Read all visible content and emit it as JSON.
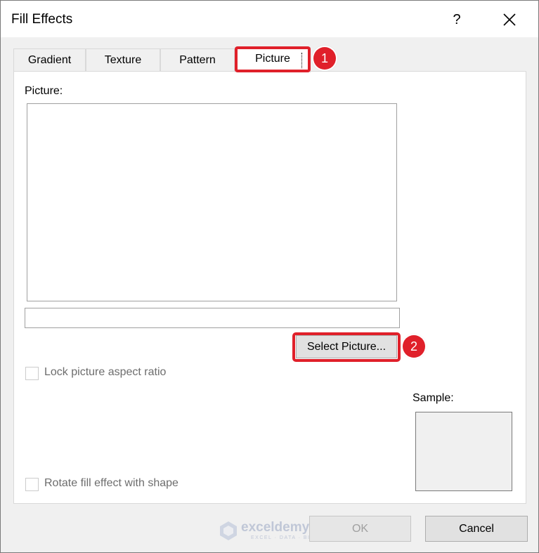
{
  "dialog": {
    "title": "Fill Effects",
    "help_label": "?"
  },
  "tabs": [
    {
      "label": "Gradient"
    },
    {
      "label": "Texture"
    },
    {
      "label": "Pattern"
    },
    {
      "label": "Picture",
      "active": true
    }
  ],
  "annotations": {
    "step1": "1",
    "step2": "2",
    "highlight_color": "#e0202a"
  },
  "panel": {
    "picture_label": "Picture:",
    "select_button": "Select Picture...",
    "lock_aspect_label": "Lock picture aspect ratio",
    "lock_aspect_checked": false,
    "rotate_label": "Rotate fill effect with shape",
    "rotate_checked": false,
    "sample_label": "Sample:"
  },
  "footer": {
    "ok_label": "OK",
    "cancel_label": "Cancel"
  },
  "watermark": {
    "name": "exceldemy",
    "tagline": "EXCEL · DATA · BI"
  }
}
